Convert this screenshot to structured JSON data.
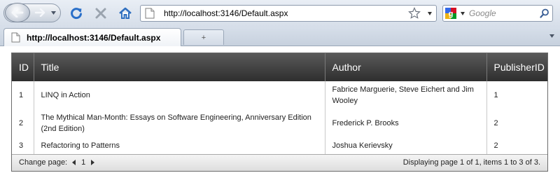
{
  "browser": {
    "url": "http://localhost:3146/Default.aspx",
    "search_placeholder": "Google",
    "tab_title": "http://localhost:3146/Default.aspx",
    "new_tab_glyph": "+"
  },
  "grid": {
    "columns": [
      "ID",
      "Title",
      "Author",
      "PublisherID"
    ],
    "rows": [
      {
        "id": "1",
        "title": "LINQ in Action",
        "author": "Fabrice Marguerie, Steve Eichert and Jim Wooley",
        "publisher": "1"
      },
      {
        "id": "2",
        "title": "The Mythical Man-Month: Essays on Software Engineering, Anniversary Edition (2nd Edition)",
        "author": "Frederick P. Brooks",
        "publisher": "2"
      },
      {
        "id": "3",
        "title": "Refactoring to Patterns",
        "author": "Joshua Kerievsky",
        "publisher": "2"
      }
    ]
  },
  "pager": {
    "label": "Change page:",
    "current_page": "1",
    "status": "Displaying page 1 of 1, items 1 to 3 of 3."
  },
  "colors": {
    "header_dark": "#2e2e2e",
    "chrome_blue": "#d6dee9",
    "reload_blue": "#2a6fc9",
    "home_blue": "#2f6fc0"
  },
  "icons": [
    "back-arrow-icon",
    "forward-arrow-icon",
    "reload-icon",
    "stop-icon",
    "home-icon",
    "page-icon",
    "star-icon",
    "google-icon",
    "search-icon"
  ]
}
